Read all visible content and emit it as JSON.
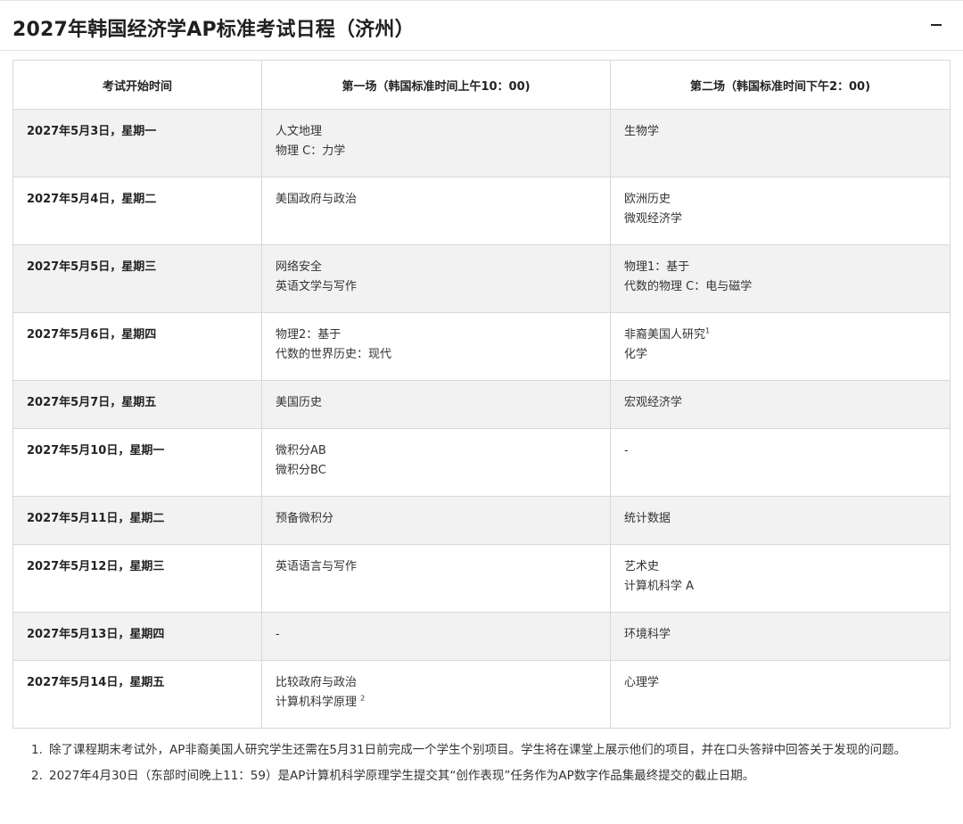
{
  "section": {
    "title": "2027年韩国经济学AP标准考试日程（济州）",
    "toggle_label": "collapse"
  },
  "table": {
    "headers": [
      "考试开始时间",
      "第一场（韩国标准时间上午10：00)",
      "第二场（韩国标准时间下午2：00)"
    ],
    "rows": [
      {
        "date": "2027年5月3日，星期一",
        "morning": [
          "人文地理",
          "物理 C：力学"
        ],
        "afternoon": [
          "生物学"
        ]
      },
      {
        "date": "2027年5月4日，星期二",
        "morning": [
          "美国政府与政治"
        ],
        "afternoon": [
          "欧洲历史",
          "微观经济学"
        ]
      },
      {
        "date": "2027年5月5日，星期三",
        "morning": [
          "网络安全",
          "英语文学与写作"
        ],
        "afternoon": [
          "物理1：基于",
          "代数的物理 C：电与磁学"
        ]
      },
      {
        "date": "2027年5月6日，星期四",
        "morning": [
          "物理2：基于",
          "代数的世界历史：现代"
        ],
        "afternoon": [
          "非裔美国人研究",
          "化学"
        ],
        "afternoon_sup": "1"
      },
      {
        "date": "2027年5月7日，星期五",
        "morning": [
          "美国历史"
        ],
        "afternoon": [
          "宏观经济学"
        ]
      },
      {
        "date": "2027年5月10日，星期一",
        "morning": [
          "微积分AB",
          "微积分BC"
        ],
        "afternoon": [
          "-"
        ]
      },
      {
        "date": "2027年5月11日，星期二",
        "morning": [
          "预备微积分"
        ],
        "afternoon": [
          "统计数据"
        ]
      },
      {
        "date": "2027年5月12日，星期三",
        "morning": [
          "英语语言与写作"
        ],
        "afternoon": [
          "艺术史",
          "计算机科学 A"
        ]
      },
      {
        "date": "2027年5月13日，星期四",
        "morning": [
          "-"
        ],
        "afternoon": [
          "环境科学"
        ]
      },
      {
        "date": "2027年5月14日，星期五",
        "morning": [
          "比较政府与政治",
          "计算机科学原理"
        ],
        "afternoon": [
          "心理学"
        ],
        "morning_sup": "2"
      }
    ]
  },
  "notes": [
    {
      "num": "1.",
      "text": "除了课程期末考试外，AP非裔美国人研究学生还需在5月31日前完成一个学生个别项目。学生将在课堂上展示他们的项目，并在口头答辩中回答关于发现的问题。"
    },
    {
      "num": "2.",
      "text": "2027年4月30日（东部时间晚上11：59）是AP计算机科学原理学生提交其“创作表现”任务作为AP数字作品集最终提交的截止日期。"
    }
  ]
}
